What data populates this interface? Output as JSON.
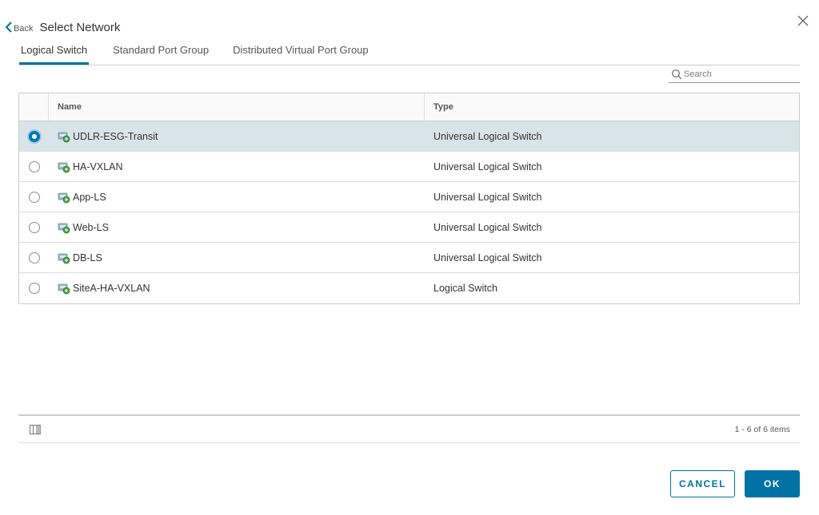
{
  "header": {
    "back_label": "Back",
    "title": "Select Network"
  },
  "tabs": [
    {
      "label": "Logical Switch",
      "active": true
    },
    {
      "label": "Standard Port Group",
      "active": false
    },
    {
      "label": "Distributed Virtual Port Group",
      "active": false
    }
  ],
  "search": {
    "placeholder": "Search",
    "value": ""
  },
  "grid": {
    "columns": [
      "Name",
      "Type"
    ],
    "rows": [
      {
        "name": "UDLR-ESG-Transit",
        "type": "Universal Logical Switch",
        "selected": true
      },
      {
        "name": "HA-VXLAN",
        "type": "Universal Logical Switch",
        "selected": false
      },
      {
        "name": "App-LS",
        "type": "Universal Logical Switch",
        "selected": false
      },
      {
        "name": "Web-LS",
        "type": "Universal Logical Switch",
        "selected": false
      },
      {
        "name": "DB-LS",
        "type": "Universal Logical Switch",
        "selected": false
      },
      {
        "name": "SiteA-HA-VXLAN",
        "type": "Logical Switch",
        "selected": false
      }
    ],
    "footer_count": "1 - 6 of 6 items"
  },
  "buttons": {
    "cancel": "CANCEL",
    "ok": "OK"
  },
  "colors": {
    "accent": "#0072a3",
    "selected_row": "#d9e4ea",
    "radio_checked": "#0079b8"
  },
  "icons": {
    "back": "chevron-left-icon",
    "close": "close-icon",
    "search": "search-icon",
    "network": "logical-switch-icon",
    "columns": "column-toggle-icon"
  }
}
